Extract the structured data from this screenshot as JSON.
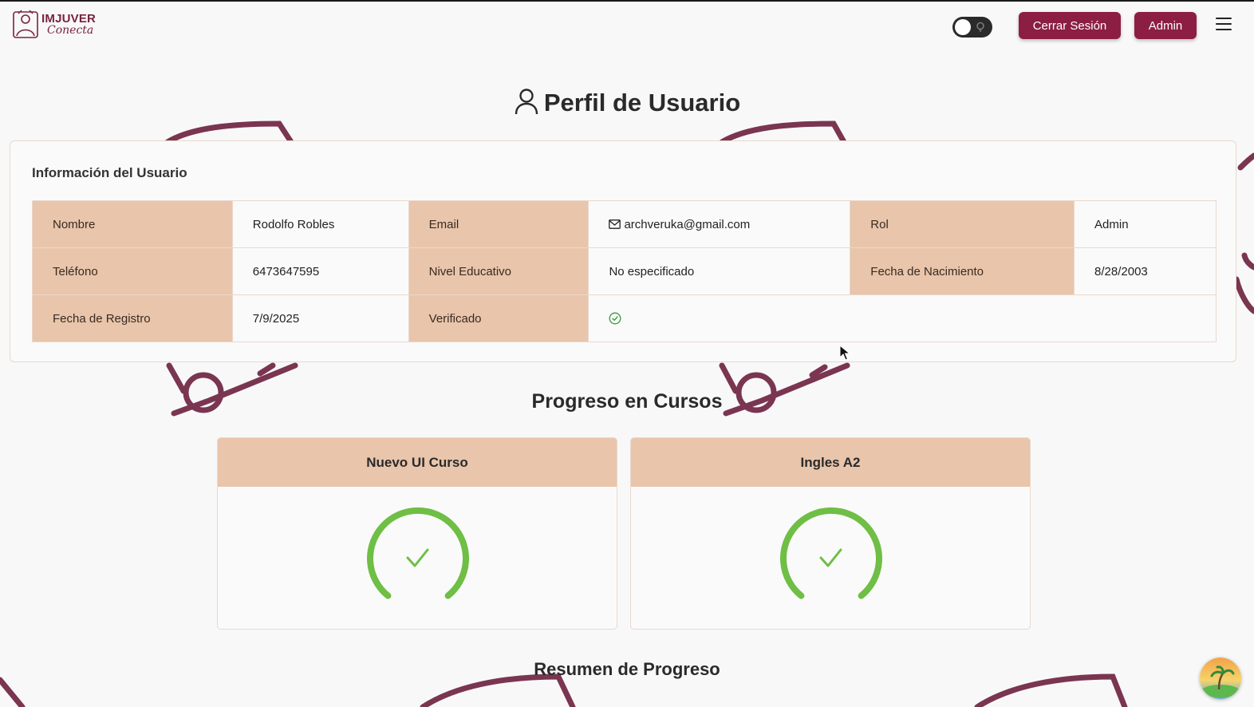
{
  "header": {
    "logo_title": "IMJUVER",
    "logo_subtitle": "Conecta",
    "logout_label": "Cerrar Sesión",
    "admin_label": "Admin"
  },
  "page": {
    "title": "Perfil de Usuario"
  },
  "user_info": {
    "heading": "Información del Usuario",
    "rows": [
      [
        {
          "label": "Nombre",
          "value": "Rodolfo Robles"
        },
        {
          "label": "Email",
          "value": "archveruka@gmail.com"
        },
        {
          "label": "Rol",
          "value": "Admin"
        }
      ],
      [
        {
          "label": "Teléfono",
          "value": "6473647595"
        },
        {
          "label": "Nivel Educativo",
          "value": "No especificado"
        },
        {
          "label": "Fecha de Nacimiento",
          "value": "8/28/2003"
        }
      ],
      [
        {
          "label": "Fecha de Registro",
          "value": "7/9/2025"
        },
        {
          "label": "Verificado",
          "value_icon": "check-circle-icon"
        }
      ]
    ]
  },
  "progress": {
    "title": "Progreso en Cursos",
    "courses": [
      {
        "name": "Nuevo UI Curso",
        "status_icon": "check-icon"
      },
      {
        "name": "Ingles A2",
        "status_icon": "check-icon"
      }
    ]
  },
  "summary": {
    "title": "Resumen de Progreso"
  },
  "colors": {
    "brand": "#8b1e42",
    "label_bg": "#e8c5ab",
    "progress_green": "#6fbe45",
    "decor": "#7a3550"
  }
}
